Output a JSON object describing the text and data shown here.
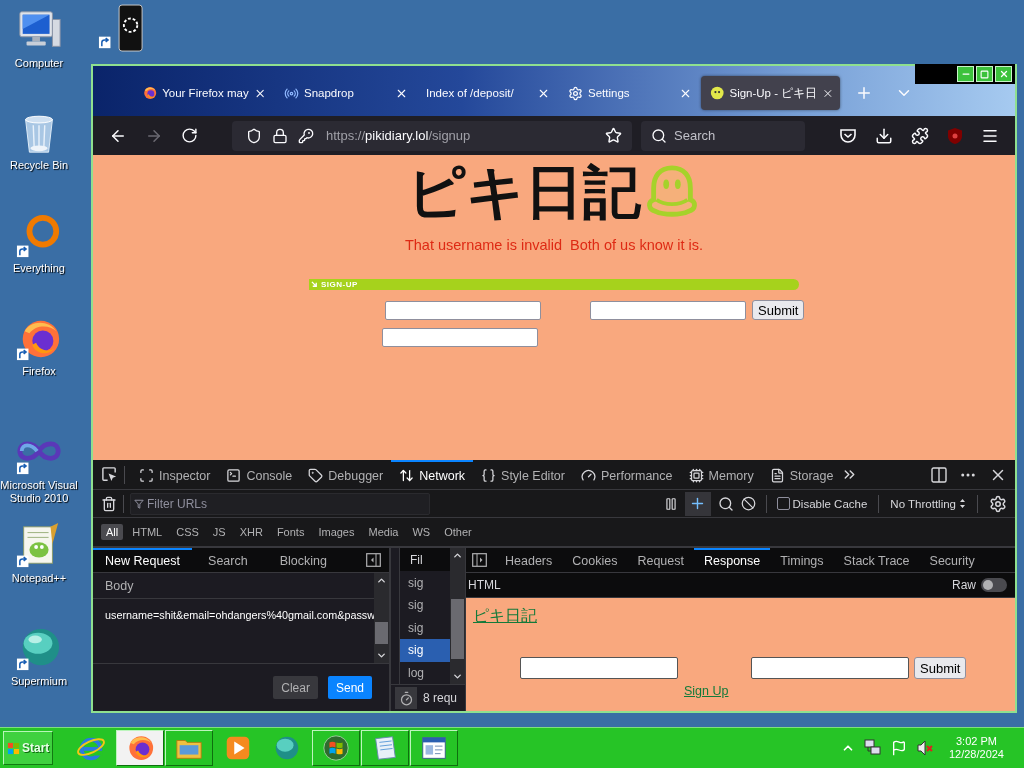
{
  "desktop": {
    "icons": [
      {
        "label": "Computer"
      },
      {
        "label": "Recycle Bin"
      },
      {
        "label": "Everything"
      },
      {
        "label": "Firefox"
      },
      {
        "label": "Microsoft Visual Studio 2010"
      },
      {
        "label": "Notepad++"
      },
      {
        "label": "Supermium"
      }
    ]
  },
  "browser": {
    "tabs": [
      {
        "title": "Your Firefox may",
        "selected": false
      },
      {
        "title": "Snapdrop",
        "selected": false
      },
      {
        "title": "Index of /deposit/",
        "selected": false
      },
      {
        "title": "Settings",
        "selected": false
      },
      {
        "title": "Sign-Up - ピキ日",
        "selected": true
      }
    ],
    "address": {
      "scheme": "https://",
      "host": "pikidiary.lol",
      "path": "/signup"
    },
    "search": {
      "placeholder": "Search"
    }
  },
  "page": {
    "logo": "ピキ日記",
    "error": "That username is invalid  Both of us know it is.",
    "section_title": "SIGN-UP",
    "submit": "Submit"
  },
  "devtools": {
    "tools": [
      {
        "label": "Inspector",
        "selected": false
      },
      {
        "label": "Console",
        "selected": false
      },
      {
        "label": "Debugger",
        "selected": false
      },
      {
        "label": "Network",
        "selected": true
      },
      {
        "label": "Style Editor",
        "selected": false
      },
      {
        "label": "Performance",
        "selected": false
      },
      {
        "label": "Memory",
        "selected": false
      },
      {
        "label": "Storage",
        "selected": false
      }
    ],
    "filter": {
      "placeholder": "Filter URLs"
    },
    "disable_cache": {
      "label": "Disable Cache",
      "checked": false
    },
    "throttling": "No Throttling",
    "type_filters": [
      {
        "label": "All",
        "selected": true
      },
      {
        "label": "HTML",
        "selected": false
      },
      {
        "label": "CSS",
        "selected": false
      },
      {
        "label": "JS",
        "selected": false
      },
      {
        "label": "XHR",
        "selected": false
      },
      {
        "label": "Fonts",
        "selected": false
      },
      {
        "label": "Images",
        "selected": false
      },
      {
        "label": "Media",
        "selected": false
      },
      {
        "label": "WS",
        "selected": false
      },
      {
        "label": "Other",
        "selected": false
      }
    ],
    "sidebar": {
      "tabs": [
        {
          "label": "New Request",
          "selected": true
        },
        {
          "label": "Search",
          "selected": false
        },
        {
          "label": "Blocking",
          "selected": false
        }
      ],
      "body_label": "Body",
      "body": "username=shit&email=ohdangers%40gmail.com&passw",
      "buttons": [
        {
          "label": "Clear",
          "primary": false
        },
        {
          "label": "Send",
          "primary": true
        }
      ]
    },
    "requests": {
      "header": "Fil",
      "rows": [
        {
          "name": "sig",
          "selected": false
        },
        {
          "name": "sig",
          "selected": false
        },
        {
          "name": "sig",
          "selected": false
        },
        {
          "name": "sig",
          "selected": true
        },
        {
          "name": "log",
          "selected": false
        }
      ],
      "summary": "8 requ"
    },
    "details": {
      "tabs": [
        {
          "label": "Headers",
          "selected": false
        },
        {
          "label": "Cookies",
          "selected": false
        },
        {
          "label": "Request",
          "selected": false
        },
        {
          "label": "Response",
          "selected": true
        },
        {
          "label": "Timings",
          "selected": false
        },
        {
          "label": "Stack Trace",
          "selected": false
        },
        {
          "label": "Security",
          "selected": false
        }
      ],
      "format": "HTML",
      "raw": {
        "label": "Raw",
        "on": false
      },
      "preview": {
        "title": "ピキ日記",
        "submit": "Submit",
        "link": "Sign Up"
      }
    }
  },
  "taskbar": {
    "start": "Start",
    "apps": [
      {
        "open": false,
        "active": false
      },
      {
        "open": true,
        "active": true
      },
      {
        "open": true,
        "active": false
      },
      {
        "open": false,
        "active": false
      },
      {
        "open": false,
        "active": false
      },
      {
        "open": true,
        "active": false
      },
      {
        "open": true,
        "active": false
      },
      {
        "open": true,
        "active": false
      }
    ],
    "clock": {
      "time": "3:02 PM",
      "date": "12/28/2024"
    }
  }
}
